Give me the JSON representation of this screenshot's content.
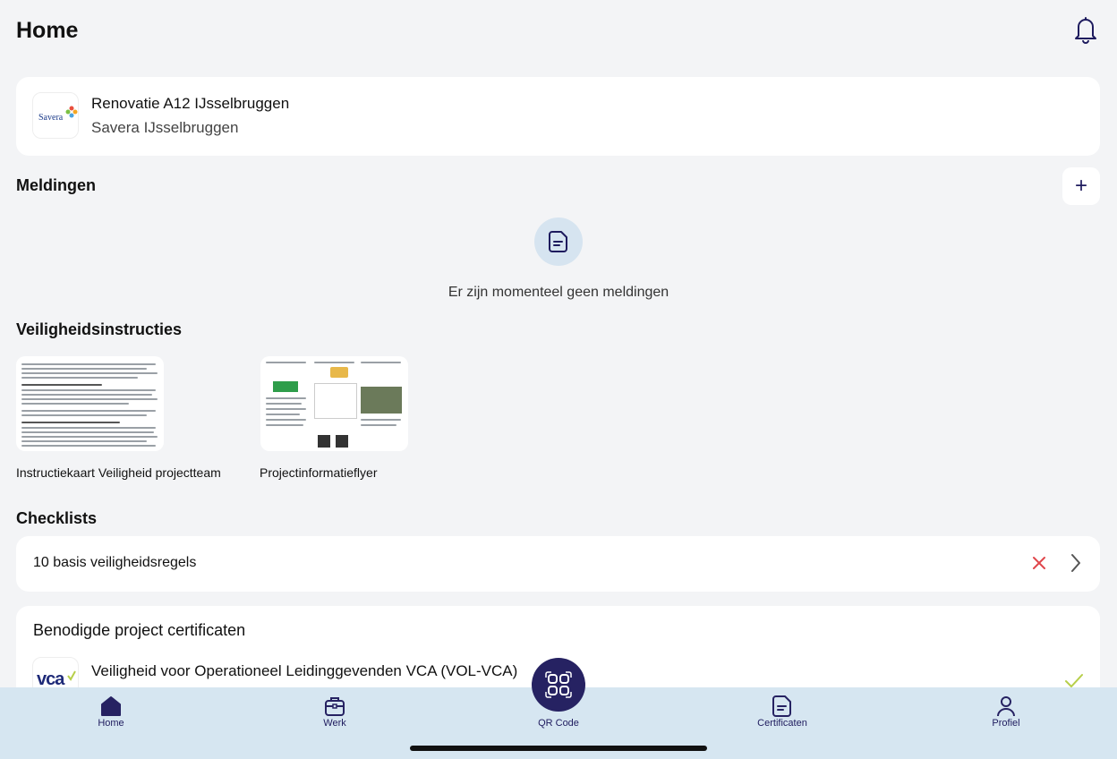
{
  "header": {
    "title": "Home",
    "notification_icon": "bell-icon"
  },
  "project": {
    "logo_text": "Savera",
    "title": "Renovatie A12 IJsselbruggen",
    "subtitle": "Savera IJsselbruggen"
  },
  "meldingen": {
    "title": "Meldingen",
    "add_label": "+",
    "empty_text": "Er zijn momenteel geen meldingen"
  },
  "veiligheidsinstructies": {
    "title": "Veiligheidsinstructies",
    "items": [
      {
        "label": "Instructiekaart Veiligheid projectteam"
      },
      {
        "label": "Projectinformatieflyer"
      }
    ]
  },
  "checklists": {
    "title": "Checklists",
    "items": [
      {
        "label": "10 basis veiligheidsregels",
        "status": "x-icon"
      }
    ]
  },
  "certificaten": {
    "title": "Benodigde project certificaten",
    "items": [
      {
        "logo_text": "vca",
        "label": "Veiligheid voor Operationeel Leidinggevenden VCA (VOL-VCA)",
        "status": "check-icon"
      }
    ]
  },
  "tabbar": {
    "tabs": [
      {
        "label": "Home",
        "icon": "home-icon"
      },
      {
        "label": "Werk",
        "icon": "briefcase-icon"
      },
      {
        "label": "QR Code",
        "icon": "qr-code-icon"
      },
      {
        "label": "Certificaten",
        "icon": "certificate-icon"
      },
      {
        "label": "Profiel",
        "icon": "profile-icon"
      }
    ]
  },
  "colors": {
    "accent": "#262262",
    "tabbar_bg": "#d6e6f1",
    "page_bg": "#f3f4f6",
    "error": "#e0474c",
    "success": "#b7cf4a"
  }
}
